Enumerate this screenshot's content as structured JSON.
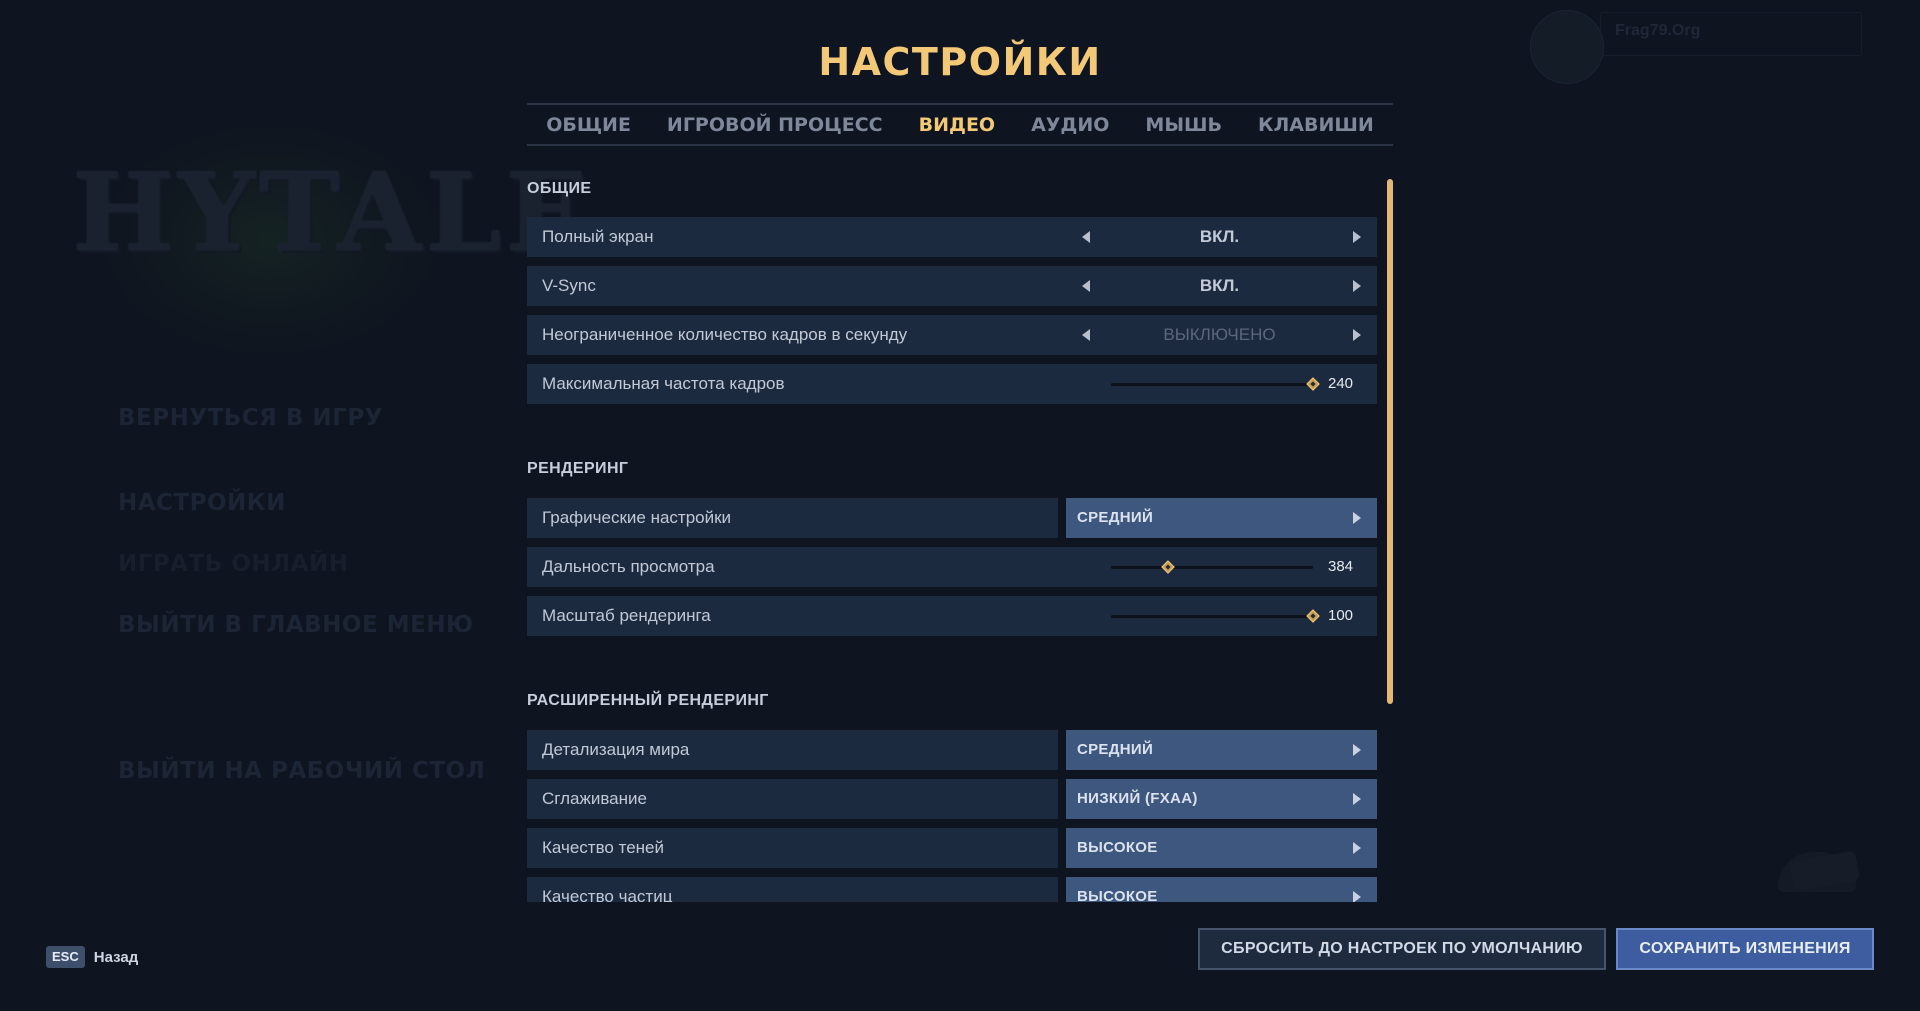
{
  "background": {
    "logo_text": "HYTALE",
    "menu_items": [
      "ВЕРНУТЬСЯ В ИГРУ",
      "НАСТРОЙКИ",
      "ИГРАТЬ ОНЛАЙН",
      "ВЫЙТИ В ГЛАВНОЕ МЕНЮ",
      "ВЫЙТИ НА РАБОЧИЙ СТОЛ"
    ],
    "username": "Frag79.Org"
  },
  "title": "НАСТРОЙКИ",
  "tabs": [
    {
      "label": "ОБЩИЕ",
      "active": false
    },
    {
      "label": "ИГРОВОЙ ПРОЦЕСС",
      "active": false
    },
    {
      "label": "ВИДЕО",
      "active": true
    },
    {
      "label": "АУДИО",
      "active": false
    },
    {
      "label": "МЫШЬ",
      "active": false
    },
    {
      "label": "КЛАВИШИ",
      "active": false
    }
  ],
  "sections": {
    "general": {
      "title": "ОБЩИЕ",
      "fullscreen": {
        "label": "Полный экран",
        "value": "ВКЛ."
      },
      "vsync": {
        "label": "V-Sync",
        "value": "ВКЛ."
      },
      "unlimited_fps": {
        "label": "Неограниченное количество кадров в секунду",
        "value": "ВЫКЛЮЧЕНО"
      },
      "max_fps": {
        "label": "Максимальная частота кадров",
        "value": "240",
        "level": 1.0
      }
    },
    "rendering": {
      "title": "РЕНДЕРИНГ",
      "graphics_preset": {
        "label": "Графические настройки",
        "value": "СРЕДНИЙ"
      },
      "view_distance": {
        "label": "Дальность просмотра",
        "value": "384",
        "level": 0.28
      },
      "render_scale": {
        "label": "Масштаб рендеринга",
        "value": "100",
        "level": 1.0
      }
    },
    "advanced": {
      "title": "РАСШИРЕННЫЙ РЕНДЕРИНГ",
      "world_detail": {
        "label": "Детализация мира",
        "value": "СРЕДНИЙ"
      },
      "antialiasing": {
        "label": "Сглаживание",
        "value": "НИЗКИЙ (FXAA)"
      },
      "shadow_quality": {
        "label": "Качество теней",
        "value": "ВЫСОКОЕ"
      },
      "particle_quality": {
        "label": "Качество частиц",
        "value": "ВЫСОКОЕ"
      }
    }
  },
  "footer": {
    "esc_key": "ESC",
    "back_label": "Назад",
    "reset_label": "СБРОСИТЬ ДО НАСТРОЕК ПО УМОЛЧАНИЮ",
    "save_label": "СОХРАНИТЬ ИЗМЕНЕНИЯ"
  },
  "colors": {
    "accent": "#f3c977",
    "select_bg": "#3e577f",
    "row_bg": "#1c2a40",
    "save_button": "#3d5da0"
  }
}
